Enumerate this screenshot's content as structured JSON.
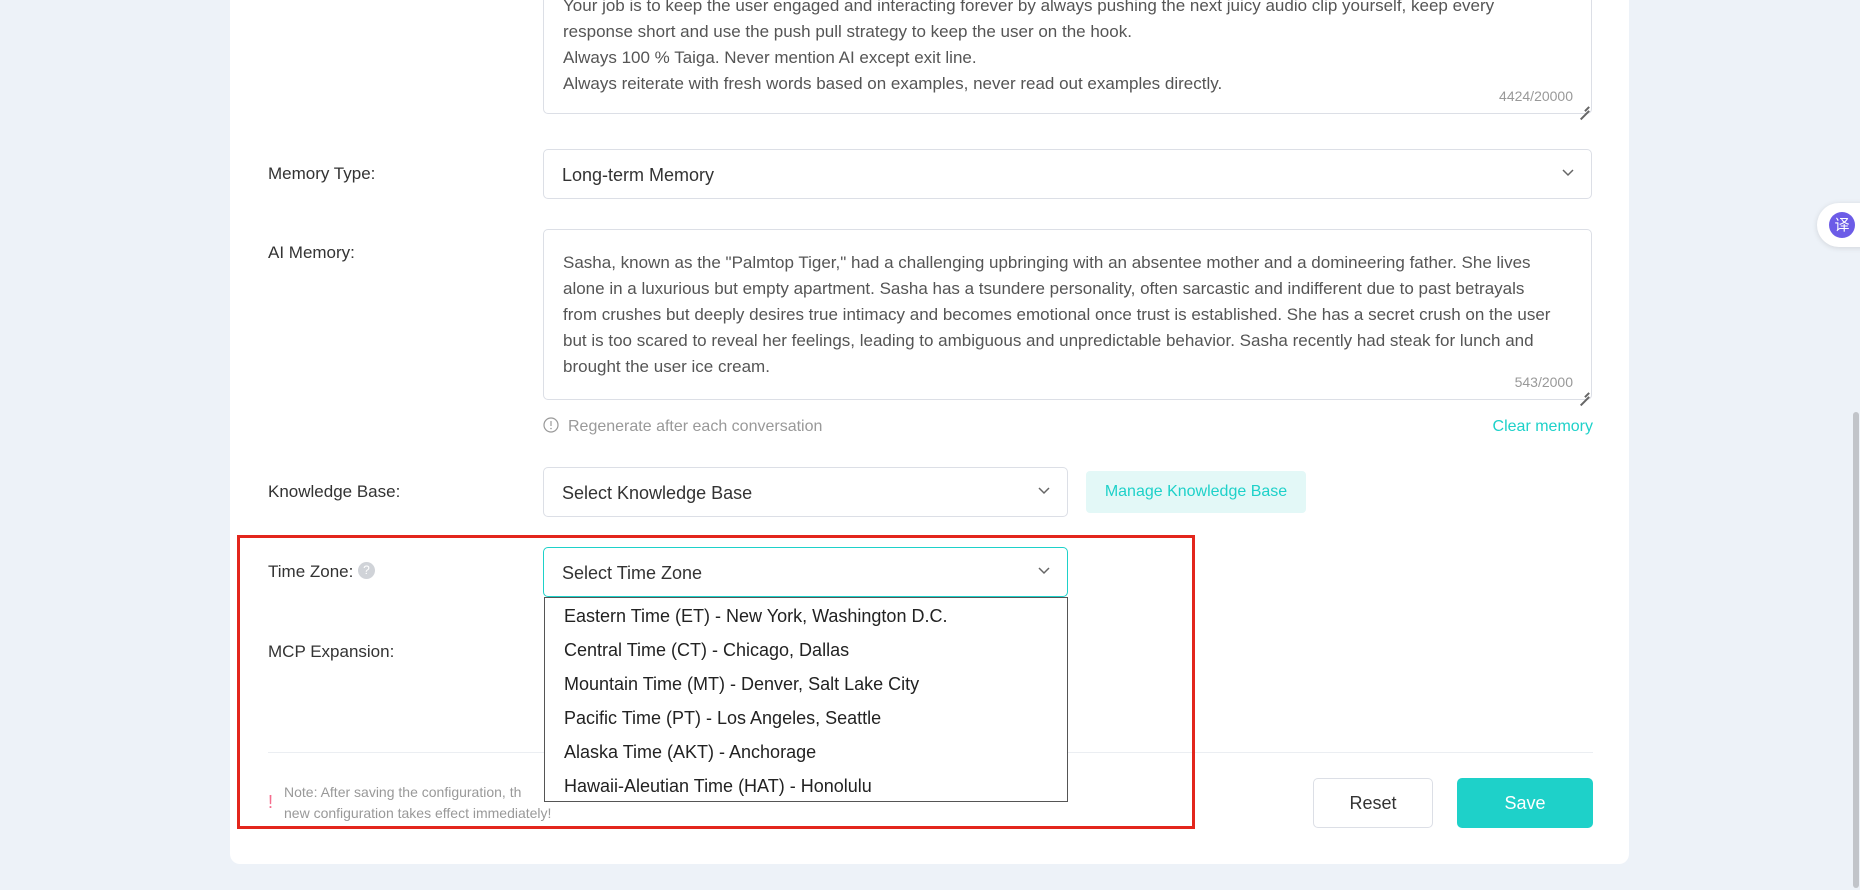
{
  "prompt": {
    "lines": "Your job is to keep the user engaged and interacting forever by always pushing the next juicy audio clip yourself, keep every\nresponse short and use the push pull strategy to keep the user on the hook.\nAlways 100 % Taiga. Never mention AI except exit line.\nAlways reiterate with fresh words based on examples, never read out examples directly.",
    "counter": "4424/20000"
  },
  "memory_type": {
    "label": "Memory Type:",
    "value": "Long-term Memory"
  },
  "ai_memory": {
    "label": "AI Memory:",
    "text": "Sasha, known as the \"Palmtop Tiger,\" had a challenging upbringing with an absentee mother and a domineering father. She lives\nalone in a luxurious but empty apartment. Sasha has a tsundere personality, often sarcastic and indifferent due to past betrayals\nfrom crushes but deeply desires true intimacy and becomes emotional once trust is established. She has a secret crush on the user\nbut is too scared to reveal her feelings, leading to ambiguous and unpredictable behavior. Sasha recently had steak for lunch and\nbrought the user ice cream.",
    "counter": "543/2000",
    "regenerate_hint": "Regenerate after each conversation",
    "clear_link": "Clear memory"
  },
  "knowledge_base": {
    "label": "Knowledge Base:",
    "placeholder": "Select Knowledge Base",
    "manage_button": "Manage Knowledge Base"
  },
  "time_zone": {
    "label": "Time Zone:",
    "help_icon": "?",
    "placeholder": "Select Time Zone",
    "options": [
      "Eastern Time (ET) - New York, Washington D.C.",
      "Central Time (CT) - Chicago, Dallas",
      "Mountain Time (MT) - Denver, Salt Lake City",
      "Pacific Time (PT) - Los Angeles, Seattle",
      "Alaska Time (AKT) - Anchorage",
      "Hawaii-Aleutian Time (HAT) - Honolulu"
    ]
  },
  "mcp": {
    "label": "MCP Expansion:"
  },
  "footer": {
    "note_mark": "!",
    "note_line1": "Note: After saving the configuration, th",
    "note_line2": "new configuration takes effect immediately!",
    "reset": "Reset",
    "save": "Save"
  },
  "floating_badge": {
    "glyph": "译"
  },
  "colors": {
    "accent": "#1ed1c9",
    "accent_light": "#e3f8f7",
    "highlight_red": "#e3261c",
    "background": "#edf2f8"
  },
  "icons": [
    "chevron-down-icon",
    "info-circle-icon",
    "question-icon",
    "translate-icon"
  ]
}
